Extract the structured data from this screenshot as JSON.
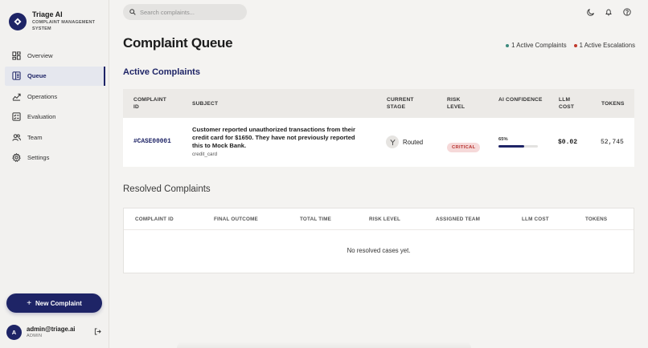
{
  "brand": {
    "name": "Triage AI",
    "subtitle": "COMPLAINT MANAGEMENT SYSTEM"
  },
  "nav": {
    "items": [
      {
        "label": "Overview",
        "icon": "grid-icon"
      },
      {
        "label": "Queue",
        "icon": "list-icon",
        "active": true
      },
      {
        "label": "Operations",
        "icon": "trend-icon"
      },
      {
        "label": "Evaluation",
        "icon": "checklist-icon"
      },
      {
        "label": "Team",
        "icon": "users-icon"
      },
      {
        "label": "Settings",
        "icon": "gear-icon"
      }
    ]
  },
  "new_complaint_button": {
    "label": "New Complaint"
  },
  "user": {
    "initial": "A",
    "email": "admin@triage.ai",
    "role": "ADMIN"
  },
  "search": {
    "placeholder": "Search complaints..."
  },
  "page": {
    "title": "Complaint Queue",
    "active_count_label": "1 Active Complaints",
    "escalation_count_label": "1 Active Escalations"
  },
  "colors": {
    "accent": "#1e2466",
    "active_dot": "#3c8a7e",
    "escalation_dot": "#c0392b",
    "critical_bg": "#f6d9d9",
    "critical_text": "#b6322f"
  },
  "active_complaints": {
    "title": "Active Complaints",
    "columns": {
      "id": "COMPLAINT ID",
      "subject": "SUBJECT",
      "stage": "CURRENT STAGE",
      "risk": "RISK LEVEL",
      "confidence": "AI CONFIDENCE",
      "cost": "LLM COST",
      "tokens": "TOKENS"
    },
    "rows": [
      {
        "id": "#CASE00001",
        "subject": "Customer reported unauthorized transactions from their credit card for $1650. They have not previously reported this to Mock Bank.",
        "category": "credit_card",
        "stage": "Routed",
        "risk": "CRITICAL",
        "confidence_label": "65%",
        "confidence": 0.65,
        "cost": "$0.02",
        "tokens": "52,745"
      }
    ]
  },
  "resolved_complaints": {
    "title": "Resolved Complaints",
    "columns": {
      "id": "COMPLAINT ID",
      "outcome": "FINAL OUTCOME",
      "time": "TOTAL TIME",
      "risk": "RISK LEVEL",
      "team": "ASSIGNED TEAM",
      "cost": "LLM COST",
      "tokens": "TOKENS"
    },
    "empty_message": "No resolved cases yet."
  }
}
